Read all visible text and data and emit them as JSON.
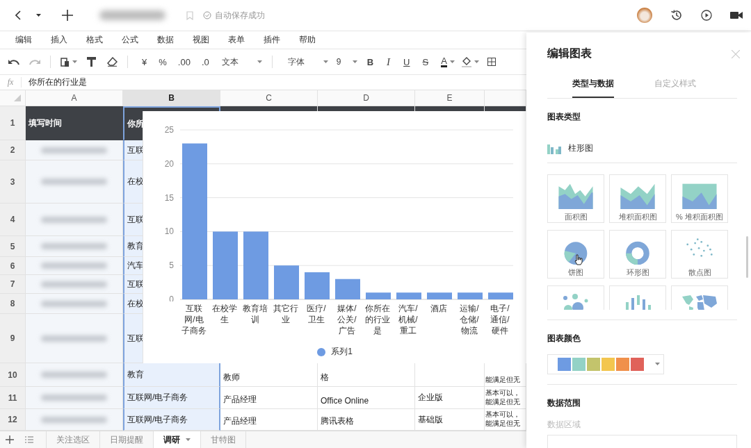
{
  "topbar": {
    "status": "自动保存成功"
  },
  "menu": [
    "编辑",
    "插入",
    "格式",
    "公式",
    "数据",
    "视图",
    "表单",
    "插件",
    "帮助"
  ],
  "toolbar": {
    "currency": "¥",
    "percent": "%",
    "add_decimal": ".00",
    "remove_decimal": ".0",
    "number_format": "文本",
    "font": "字体",
    "font_size": "9",
    "bold": "B",
    "italic": "I",
    "underline": "U",
    "strikethrough": "S",
    "font_color": "A"
  },
  "formula_bar": {
    "label": "fx",
    "value": "你所在的行业是"
  },
  "sheet": {
    "columns": [
      {
        "label": "A",
        "selected": false
      },
      {
        "label": "B",
        "selected": true
      },
      {
        "label": "C",
        "selected": false
      },
      {
        "label": "D",
        "selected": false
      },
      {
        "label": "E",
        "selected": false
      }
    ],
    "rows": [
      {
        "number": "1",
        "kind": "header",
        "cells": {
          "A": "填写时间",
          "B": "你所"
        }
      },
      {
        "number": "2",
        "kind": "data",
        "cells": {
          "B": "互联"
        }
      },
      {
        "number": "3",
        "kind": "data",
        "cells": {
          "B": "在校"
        }
      },
      {
        "number": "4",
        "kind": "data",
        "cells": {
          "B": "互联"
        }
      },
      {
        "number": "5",
        "kind": "data",
        "cells": {
          "B": "教育"
        }
      },
      {
        "number": "6",
        "kind": "data",
        "cells": {
          "B": "汽车"
        }
      },
      {
        "number": "7",
        "kind": "data",
        "cells": {
          "B": "互联"
        }
      },
      {
        "number": "8",
        "kind": "data",
        "cells": {
          "B": "在校"
        }
      },
      {
        "number": "9",
        "kind": "data",
        "cells": {
          "B": "互联"
        }
      },
      {
        "number": "10",
        "kind": "data",
        "cells": {
          "B": "教育",
          "C": "教师",
          "D": "格",
          "F": "能满足但无"
        }
      },
      {
        "number": "11",
        "kind": "data",
        "cells": {
          "B": "互联网/电子商务",
          "C": "产品经理",
          "D": "Office Online",
          "E": "企业版",
          "F": "基本可以，能满足但无"
        }
      },
      {
        "number": "12",
        "kind": "data",
        "cells": {
          "B": "互联网/电子商务",
          "C": "产品经理",
          "D": "腾讯表格",
          "E": "基础版",
          "F": "基本可以，能满足但无"
        }
      }
    ]
  },
  "chart": {
    "chart_data": {
      "type": "bar",
      "categories": [
        "互联网/电子商务",
        "在校学生",
        "教育培训",
        "其它行业",
        "医疗/卫生",
        "媒体/公关/广告",
        "你所在的行业是",
        "汽车/机械/重工",
        "酒店",
        "运输/仓储/物流",
        "电子/通信/硬件"
      ],
      "series": [
        {
          "name": "系列1",
          "color": "#6e9be2",
          "values": [
            23,
            10,
            10,
            5,
            4,
            3,
            1,
            1,
            1,
            1,
            1
          ]
        }
      ],
      "ylim": [
        0,
        25
      ],
      "yticks": [
        0,
        5,
        10,
        15,
        20,
        25
      ],
      "grid": true
    }
  },
  "sheet_tabs": [
    {
      "label": "关注选区",
      "selected": false
    },
    {
      "label": "日期提醒",
      "selected": false
    },
    {
      "label": "调研",
      "selected": true
    },
    {
      "label": "甘特图",
      "selected": false
    }
  ],
  "panel": {
    "title": "编辑图表",
    "tabs": [
      {
        "label": "类型与数据",
        "selected": true
      },
      {
        "label": "自定义样式",
        "selected": false
      }
    ],
    "type_heading": "图表类型",
    "current_type": "柱形图",
    "chart_types": [
      {
        "kind": "area",
        "label": "面积图"
      },
      {
        "kind": "stacked_area",
        "label": "堆积面积图"
      },
      {
        "kind": "percent_area",
        "label": "% 堆积面积图"
      },
      {
        "kind": "pie",
        "label": "饼图"
      },
      {
        "kind": "donut",
        "label": "环形图"
      },
      {
        "kind": "scatter",
        "label": "散点图"
      },
      {
        "kind": "bubble"
      },
      {
        "kind": "candlestick"
      },
      {
        "kind": "map"
      }
    ],
    "color_heading": "图表颜色",
    "chart_colors": [
      {
        "color": "#6e9be2"
      },
      {
        "color": "#93d2c6"
      },
      {
        "color": "#c3c46c"
      },
      {
        "color": "#f3c64f"
      },
      {
        "color": "#f0904b"
      },
      {
        "color": "#e0625a"
      }
    ],
    "range_heading": "数据范围",
    "range_label": "数据区域"
  }
}
